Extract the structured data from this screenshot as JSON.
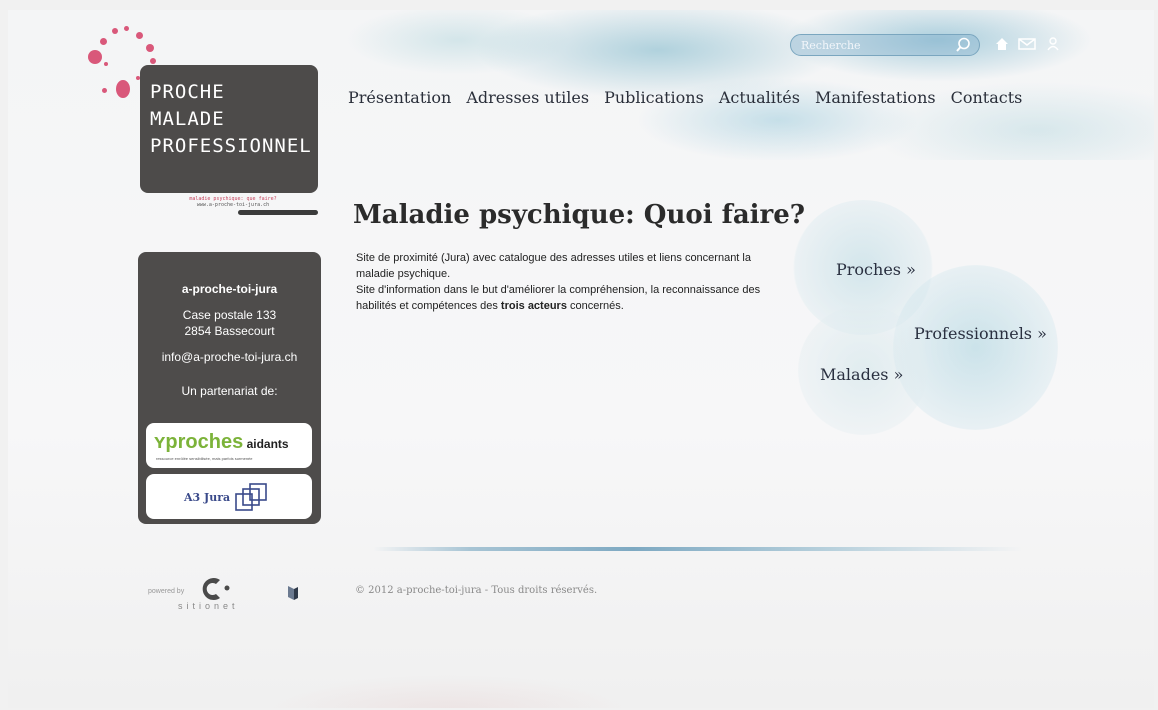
{
  "logo": {
    "lines": [
      "PROCHE",
      "MALADE",
      "PROFESSIONNEL"
    ],
    "tagline": "maladie psychique: que faire?",
    "tagline_url": "www.a-proche-toi-jura.ch"
  },
  "nav": {
    "items": [
      "Présentation",
      "Adresses utiles",
      "Publications",
      "Actualités",
      "Manifestations",
      "Contacts"
    ]
  },
  "search": {
    "placeholder": "Recherche"
  },
  "top_icons": [
    "home-icon",
    "mail-icon",
    "user-icon"
  ],
  "sidebar": {
    "title": "a-proche-toi-jura",
    "address_line1": "Case postale 133",
    "address_line2": "2854 Bassecourt",
    "email": "info@a-proche-toi-jura.ch",
    "partners_label": "Un partenariat de:",
    "partner1": {
      "word1": "proches",
      "word2": "aidants",
      "sub": "ressource enrôlée sensibilisée, mais parfois surmenée"
    },
    "partner2": {
      "text": "A3 Jura"
    }
  },
  "main": {
    "title": "Maladie psychique: Quoi faire?",
    "intro_part1": "Site  de proximité (Jura) avec catalogue des adresses  utiles et liens concernant la maladie psychique.",
    "intro_part2": "Site d'information dans le but d'améliorer la compréhension, la reconnaissance des habilités et compétences des ",
    "intro_bold": "trois acteurs",
    "intro_part3": " concernés."
  },
  "circles": {
    "proches": "Proches »",
    "professionnels": "Professionnels »",
    "malades": "Malades »"
  },
  "footer": {
    "powered_by": "powered by",
    "brand": "sitionet",
    "copyright": "© 2012 a-proche-toi-jura - Tous droits réservés."
  },
  "colors": {
    "accent_pink": "#d9587a",
    "dark_panel": "#4e4c4b",
    "partner_green": "#7cb33a",
    "watercolor_blue": "#7ea9c2"
  }
}
